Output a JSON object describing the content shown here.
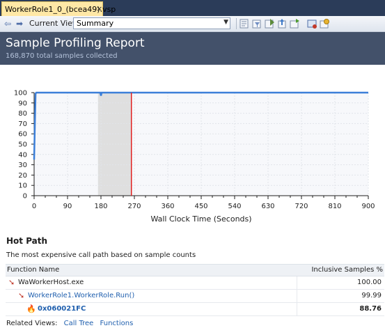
{
  "tab": {
    "title": "WorkerRole1_0_(bcea49).vsp",
    "close_glyph": "×"
  },
  "toolbar": {
    "back_glyph": "⇦",
    "forward_glyph": "➡",
    "current_view_label": "Current View:",
    "current_view_value": "Summary",
    "buttons": [
      "show-trimmed-calls-icon",
      "filter-icon",
      "compare-icon",
      "export-icon",
      "save-analyzed-icon",
      "show-marks-icon",
      "settings-icon"
    ]
  },
  "header": {
    "title": "Sample Profiling Report",
    "subtitle": "168,870 total samples collected"
  },
  "chart_data": {
    "type": "line",
    "xlabel": "Wall Clock Time (Seconds)",
    "ylabel": "",
    "xlim": [
      0,
      900
    ],
    "ylim": [
      0,
      100
    ],
    "xticks": [
      0,
      90,
      180,
      270,
      360,
      450,
      540,
      630,
      720,
      810,
      900
    ],
    "yticks": [
      0,
      10,
      20,
      30,
      40,
      50,
      60,
      70,
      80,
      90,
      100
    ],
    "series": [
      {
        "color": "#3c7fd8",
        "x": [
          0,
          2,
          4,
          6,
          178,
          180,
          182,
          900
        ],
        "y": [
          35,
          70,
          99,
          100,
          100,
          97,
          100,
          100
        ]
      }
    ],
    "selection": {
      "x_start": 172,
      "x_end": 262,
      "color": "#d8d8d8"
    },
    "marker": {
      "x": 262,
      "color": "#e02020"
    },
    "grid": true,
    "legend": "none"
  },
  "hot_path": {
    "title": "Hot Path",
    "description": "The most expensive call path based on sample counts",
    "col_function": "Function Name",
    "col_samples": "Inclusive Samples %",
    "rows": [
      {
        "name": "WaWorkerHost.exe",
        "value": "100.00"
      },
      {
        "name": "WorkerRole1.WorkerRole.Run()",
        "value": "99.99"
      },
      {
        "name": "0x060021FC",
        "value": "88.76"
      }
    ]
  },
  "related": {
    "label": "Related Views:",
    "call_tree": "Call Tree",
    "functions": "Functions"
  }
}
